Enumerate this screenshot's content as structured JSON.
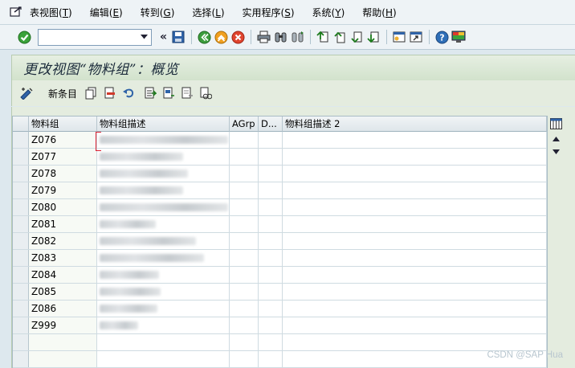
{
  "menu": [
    {
      "label": "表视图",
      "key": "T"
    },
    {
      "label": "编辑",
      "key": "E"
    },
    {
      "label": "转到",
      "key": "G"
    },
    {
      "label": "选择",
      "key": "L"
    },
    {
      "label": "实用程序",
      "key": "S"
    },
    {
      "label": "系统",
      "key": "Y"
    },
    {
      "label": "帮助",
      "key": "H"
    }
  ],
  "command_field": {
    "value": "",
    "placeholder": ""
  },
  "page_title": "更改视图“物料组”：概览",
  "app_toolbar": {
    "new_entries_label": "新条目"
  },
  "table": {
    "columns": [
      "物料组",
      "物料组描述",
      "AGrp",
      "D...",
      "物料组描述 2"
    ],
    "rows": [
      {
        "group": "Z076"
      },
      {
        "group": "Z077"
      },
      {
        "group": "Z078"
      },
      {
        "group": "Z079"
      },
      {
        "group": "Z080"
      },
      {
        "group": "Z081"
      },
      {
        "group": "Z082"
      },
      {
        "group": "Z083"
      },
      {
        "group": "Z084"
      },
      {
        "group": "Z085"
      },
      {
        "group": "Z086"
      },
      {
        "group": "Z999"
      }
    ]
  },
  "watermark": "CSDN @SAP Hua",
  "colors": {
    "title_bg": "#d8e6d2",
    "menu_bg": "#eef3f6",
    "grid_header": "#e3e9ed",
    "accent_blue": "#1f5fa0"
  },
  "icons": {
    "menu": "table-view-icon",
    "toolbar": [
      "enter-check-icon",
      "save-icon",
      "back-icon",
      "exit-icon",
      "cancel-icon",
      "print-icon",
      "find-icon",
      "find-next-icon",
      "first-page-icon",
      "prev-page-icon",
      "next-page-icon",
      "last-page-icon",
      "new-session-icon",
      "shortcut-icon",
      "help-icon",
      "customize-icon"
    ],
    "app": [
      "display-change-icon",
      "copy-icon",
      "delete-icon",
      "undo-icon",
      "select-all-icon",
      "select-block-icon",
      "deselect-all-icon",
      "details-icon"
    ]
  }
}
